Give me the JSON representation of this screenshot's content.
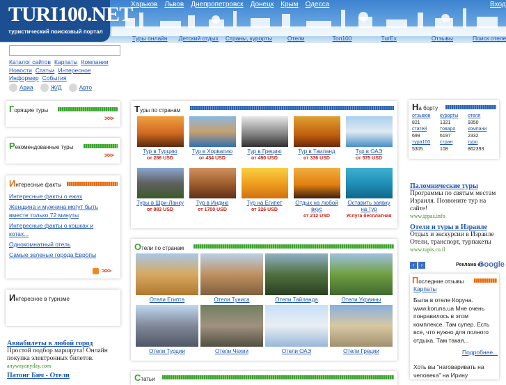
{
  "header": {
    "logo": "TURI100.NET",
    "tagline": "туристический поисковый портал",
    "cities": [
      "Харьков",
      "Львов",
      "Днепропетровск",
      "Донецк",
      "Крым",
      "Одесса"
    ],
    "login": "Вход"
  },
  "topnav": [
    "Туры онлайн",
    "Детский отдых",
    "Страны, курорты",
    "Отели",
    "Топ100",
    "TurEx",
    "Отзывы",
    "Поиск отелей"
  ],
  "sidebar": {
    "links": [
      "Каталог сайтов",
      "Карпаты",
      "Компании",
      "Новости",
      "Статьи",
      "Интересное",
      "Информер",
      "События"
    ],
    "transport": [
      "Авиа",
      "Ж/Д",
      "Авто"
    ]
  },
  "hot_tours": {
    "cap": "Г",
    "rest": "орящие туры",
    "more": ">>>"
  },
  "recommended": {
    "cap": "Р",
    "rest": "екомендованные туры",
    "more": ">>>"
  },
  "facts": {
    "cap": "И",
    "rest": "нтересные факты",
    "items": [
      "Интересные факты о ежах",
      "Женщина и мужчина могут быть вместе только 72 минуты",
      "Интересные факты о кошках и котах...",
      "Однокомнатный отель",
      "Самые зеленые города Европы"
    ],
    "more": ">>>"
  },
  "interesting": {
    "cap": "И",
    "rest": "нтересное в туризме"
  },
  "left_ad": {
    "title": "Авиабилеты в любой город",
    "desc": "Простой подбор маршрута! Онлайн покупка электронных билетов.",
    "url": "anywayanyday.com",
    "title2": "Патонг Бич - Отели"
  },
  "tours_by_country": {
    "cap": "Т",
    "rest": "уры по странам",
    "tiles": [
      {
        "name": "Тур в Турцию",
        "price": "от 286 USD"
      },
      {
        "name": "Тур в Хорватию",
        "price": "от 434 USD"
      },
      {
        "name": "Тур в Грецию",
        "price": "от 490 USD"
      },
      {
        "name": "Тур в Таиланд",
        "price": "от 336 USD"
      },
      {
        "name": "Тур в ОАЭ",
        "price": "от 575 USD"
      },
      {
        "name": "Туры в Шри-Ланку",
        "price": "от 983 USD"
      },
      {
        "name": "Тур в Индию",
        "price": "от 1700 USD"
      },
      {
        "name": "Тур на Египет",
        "price": "от 326 USD"
      },
      {
        "name": "Отдых на любой вкус",
        "price": "от 212 USD"
      },
      {
        "name": "Оставить заявку на тур",
        "price": "Услуга бесплатная"
      }
    ]
  },
  "hotels_by_country": {
    "cap": "О",
    "rest": "тели по странам",
    "items": [
      "Отели Египта",
      "Отели Туниса",
      "Отели Тайланда",
      "Отели Украины",
      "Отели Турции",
      "Отели Чехии",
      "Отели ОАЭ",
      "Отели Греции"
    ]
  },
  "articles": {
    "cap": "С",
    "rest": "татьи"
  },
  "onboard": {
    "cap": "Н",
    "rest": "а борту",
    "stats": [
      {
        "label": "отзывов",
        "value": "821"
      },
      {
        "label": "курорты",
        "value": "1321"
      },
      {
        "label": "отеля",
        "value": "9350"
      },
      {
        "label": "статей",
        "value": "699"
      },
      {
        "label": "товаро",
        "value": "6197"
      },
      {
        "label": "компани",
        "value": "2332"
      },
      {
        "label": "тура100",
        "value": "5305"
      },
      {
        "label": "стран",
        "value": "108"
      },
      {
        "label": "туро",
        "value": "862393"
      }
    ]
  },
  "right_ads": [
    {
      "title": "Паломнические туры",
      "desc": "Программы по святым местам Израиля. Позвоните тур на сайте!",
      "url": "www.ippas.info"
    },
    {
      "title": "Отели и туры в Израиле",
      "desc": "Отдых и экскурсии в Израиле Отели, транспорт, турпакеты",
      "url": "www.tupis.co.il"
    }
  ],
  "ads_label": "Реклама от",
  "google": "Google",
  "reviews": {
    "cap": "П",
    "rest": "оследние отзывы",
    "link": "Карпаты",
    "text": "Была в отеле Коруна. www.koruna.ua Мне очень понравилось в этом комплексе. Там супер. Есть все, что нужно для полного отдыха. Там такая...",
    "more": "Подробнее...",
    "text2": "Хоть вы \"наговаривать на человека\" на Ирину"
  },
  "colors": {
    "green": "#3aa32f",
    "orange": "#e86a10",
    "blue": "#2c63b5",
    "link": "#1a55b0",
    "price": "#c81e10"
  }
}
